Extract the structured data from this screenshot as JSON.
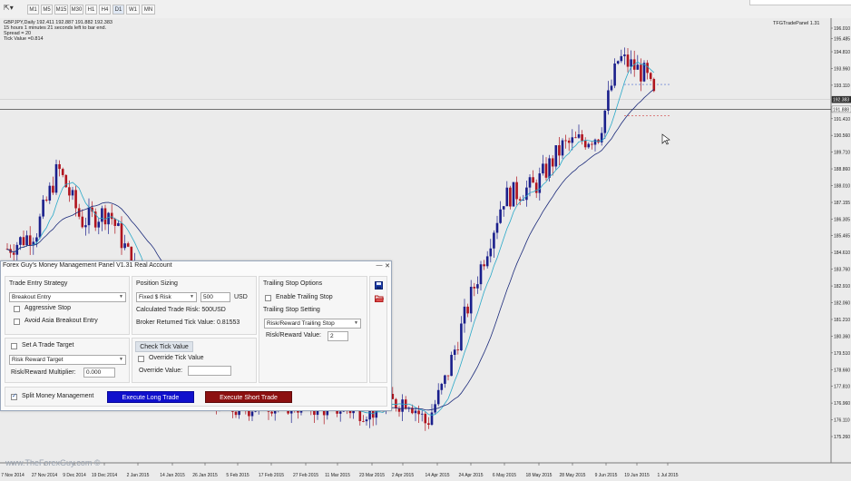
{
  "toolbar": {
    "cursor_glyph": "⇱▾",
    "timeframes": [
      "M1",
      "M5",
      "M15",
      "M30",
      "H1",
      "H4",
      "D1",
      "W1",
      "MN"
    ],
    "active_timeframe": "D1"
  },
  "chart": {
    "ohlc_line": "GBPJPY,Daily  192.411 192.887 191.882 192.383",
    "time_left": "15 hours 1 minutes 21 seconds left to bar end.",
    "spread": "Spread = 20",
    "tick_value": "Tick Value =0.814",
    "indicator_name": "TFGTradePanel 1.31",
    "price_labels": [
      "196.010",
      "195.485",
      "194.810",
      "193.960",
      "193.110",
      "192.383",
      "191.888",
      "191.410",
      "190.560",
      "189.710",
      "188.860",
      "188.010",
      "187.155",
      "186.305",
      "185.465",
      "184.610",
      "183.760",
      "182.910",
      "182.060",
      "181.210",
      "180.360",
      "179.510",
      "178.660",
      "177.810",
      "176.960",
      "176.110",
      "175.260"
    ],
    "current_price_label": "192.383",
    "bid_line_label": "191.888",
    "date_labels": [
      "7 Nov 2014",
      "27 Nov 2014",
      "9 Dec 2014",
      "19 Dec 2014",
      "2 Jan 2015",
      "14 Jan 2015",
      "26 Jan 2015",
      "5 Feb 2015",
      "17 Feb 2015",
      "27 Feb 2015",
      "11 Mar 2015",
      "23 Mar 2015",
      "2 Apr 2015",
      "14 Apr 2015",
      "24 Apr 2015",
      "6 May 2015",
      "18 May 2015",
      "28 May 2015",
      "9 Jun 2015",
      "19 Jun 2015",
      "1 Jul 2015"
    ],
    "watermark": "www.TheForexGuy.com ©",
    "colors": {
      "bull": "#1a1f8c",
      "bear": "#b0141e",
      "fast_ma": "#29a8c8",
      "slow_ma": "#1b2a7a",
      "background": "#ebebeb",
      "price_line": "#444444"
    }
  },
  "panel": {
    "title": "Forex Guy's Money Management Panel V1.31 Real Account",
    "minimize_glyph": "—",
    "close_glyph": "✕",
    "entry": {
      "heading": "Trade Entry Strategy",
      "strategy_value": "Breakout Entry",
      "aggressive_stop_label": "Aggressive Stop",
      "avoid_asia_label": "Avoid Asia Breakout Entry"
    },
    "sizing": {
      "heading": "Position Sizing",
      "mode_value": "Fixed $ Risk",
      "amount_value": "500",
      "currency": "USD",
      "calc_risk_text": "Calculated Trade Risk: 500USD",
      "tick_value_text": "Broker Returned Tick Value: 0.81553"
    },
    "trailing": {
      "heading": "Trailing Stop Options",
      "enable_label": "Enable Trailing Stop",
      "setting_label": "Trailing Stop Setting",
      "setting_value": "Risk/Reward Trailing Stop",
      "rr_label": "Risk/Reward Value:",
      "rr_value": "2"
    },
    "target": {
      "set_target_label": "Set A Trade Target",
      "target_value": "Risk Reward Target",
      "multiplier_label": "Risk/Reward Multiplier:",
      "multiplier_value": "0.000"
    },
    "tick": {
      "check_button": "Check Tick Value",
      "override_label": "Override Tick Value",
      "override_value_label": "Override Value:",
      "override_value": ""
    },
    "footer": {
      "split_label": "Split Money Management",
      "long_button": "Execute Long Trade",
      "short_button": "Execute Short Trade"
    }
  }
}
